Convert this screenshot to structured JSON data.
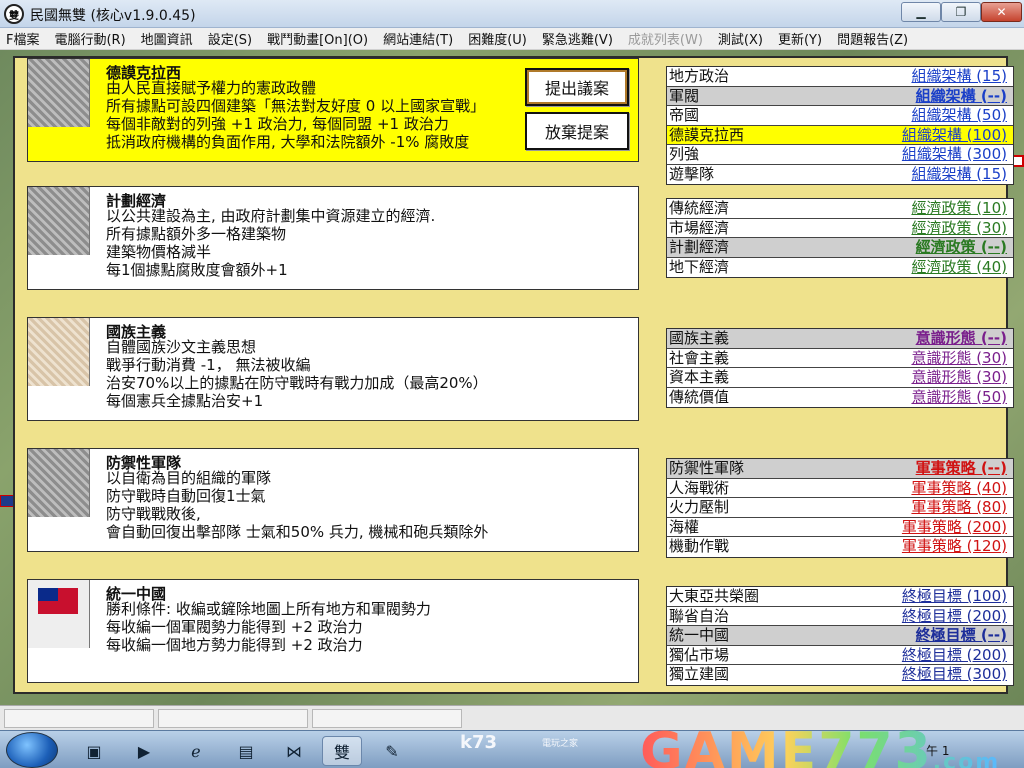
{
  "window": {
    "title": "民國無雙 (核心v1.9.0.45)",
    "icon_text": "雙",
    "minimize_label": "▁",
    "maximize_label": "❐",
    "close_label": "✕"
  },
  "menu": [
    {
      "label": "F檔案",
      "enabled": true
    },
    {
      "label": "電腦行動(R)",
      "enabled": true
    },
    {
      "label": "地圖資訊",
      "enabled": true
    },
    {
      "label": "設定(S)",
      "enabled": true
    },
    {
      "label": "戰鬥動畫[On](O)",
      "enabled": true
    },
    {
      "label": "網站連結(T)",
      "enabled": true
    },
    {
      "label": "困難度(U)",
      "enabled": true
    },
    {
      "label": "緊急逃難(V)",
      "enabled": true
    },
    {
      "label": "成就列表(W)",
      "enabled": false
    },
    {
      "label": "測試(X)",
      "enabled": true
    },
    {
      "label": "更新(Y)",
      "enabled": true
    },
    {
      "label": "問題報告(Z)",
      "enabled": true
    }
  ],
  "actions": {
    "propose": "提出議案",
    "abandon": "放棄提案"
  },
  "policies": [
    {
      "title": "德謨克拉西",
      "image": "policy-portrait-image",
      "lines": [
        "由人民直接賦予權力的憲政政體",
        "所有據點可設四個建築「無法對友好度 0 以上國家宣戰」",
        "每個非敵對的列強 +1 政治力, 每個同盟 +1 政治力",
        "抵消政府機構的負面作用, 大學和法院額外 -1% 腐敗度"
      ]
    },
    {
      "title": "計劃經濟",
      "image": "policy-portrait-image",
      "lines": [
        "以公共建設為主, 由政府計劃集中資源建立的經濟.",
        "所有據點額外多一格建築物",
        "建築物價格減半",
        "每1個據點腐敗度會額外+1"
      ]
    },
    {
      "title": "國族主義",
      "image": "policy-poster-image",
      "lines": [
        "自體國族沙文主義思想",
        "戰爭行動消費 -1， 無法被收編",
        "治安70%以上的據點在防守戰時有戰力加成（最高20%）",
        "每個憲兵全據點治安+1"
      ]
    },
    {
      "title": "防禦性軍隊",
      "image": "policy-portrait-image",
      "lines": [
        "以自衛為目的組織的軍隊",
        "防守戰時自動回復1士氣",
        "防守戰戰敗後,",
        "會自動回復出擊部隊 士氣和50% 兵力, 機械和砲兵類除外"
      ]
    },
    {
      "title": "統一中國",
      "image": "policy-flag-image",
      "lines": [
        "勝利條件: 收編或鏟除地圖上所有地方和軍閥勢力",
        "每收編一個軍閥勢力能得到 +2 政治力",
        "每收編一個地方勢力能得到 +2 政治力"
      ]
    }
  ],
  "option_groups": [
    {
      "color": "blue",
      "items": [
        {
          "name": "地方政治",
          "category": "組織架構 (15)",
          "state": "normal"
        },
        {
          "name": "軍閥",
          "category": "組織架構 (--)",
          "state": "active"
        },
        {
          "name": "帝國",
          "category": "組織架構 (50)",
          "state": "normal"
        },
        {
          "name": "德謨克拉西",
          "category": "組織架構 (100)",
          "state": "highlight"
        },
        {
          "name": "列強",
          "category": "組織架構 (300)",
          "state": "normal"
        },
        {
          "name": "遊擊隊",
          "category": "組織架構 (15)",
          "state": "normal"
        }
      ]
    },
    {
      "color": "green",
      "items": [
        {
          "name": "傳統經濟",
          "category": "經濟政策 (10)",
          "state": "normal"
        },
        {
          "name": "市場經濟",
          "category": "經濟政策 (30)",
          "state": "normal"
        },
        {
          "name": "計劃經濟",
          "category": "經濟政策 (--)",
          "state": "active"
        },
        {
          "name": "地下經濟",
          "category": "經濟政策 (40)",
          "state": "normal"
        }
      ]
    },
    {
      "color": "purple",
      "items": [
        {
          "name": "國族主義",
          "category": "意識形態 (--)",
          "state": "active"
        },
        {
          "name": "社會主義",
          "category": "意識形態 (30)",
          "state": "normal"
        },
        {
          "name": "資本主義",
          "category": "意識形態 (30)",
          "state": "normal"
        },
        {
          "name": "傳統價值",
          "category": "意識形態 (50)",
          "state": "normal"
        }
      ]
    },
    {
      "color": "red",
      "items": [
        {
          "name": "防禦性軍隊",
          "category": "軍事策略 (--)",
          "state": "active"
        },
        {
          "name": "人海戰術",
          "category": "軍事策略 (40)",
          "state": "normal"
        },
        {
          "name": "火力壓制",
          "category": "軍事策略 (80)",
          "state": "normal"
        },
        {
          "name": "海權",
          "category": "軍事策略 (200)",
          "state": "normal"
        },
        {
          "name": "機動作戰",
          "category": "軍事策略 (120)",
          "state": "normal"
        }
      ]
    },
    {
      "color": "navy",
      "items": [
        {
          "name": "大東亞共榮圈",
          "category": "終極目標 (100)",
          "state": "normal"
        },
        {
          "name": "聯省自治",
          "category": "終極目標 (200)",
          "state": "normal"
        },
        {
          "name": "統一中國",
          "category": "終極目標 (--)",
          "state": "active"
        },
        {
          "name": "獨佔市場",
          "category": "終極目標 (200)",
          "state": "normal"
        },
        {
          "name": "獨立建國",
          "category": "終極目標 (300)",
          "state": "normal"
        }
      ]
    }
  ],
  "taskbar": {
    "watermark_site": "k73",
    "watermark_site_sub": "電玩之家",
    "watermark_brand": "GAME773",
    "watermark_brand_sub": ".com",
    "tray_text": "午 1"
  },
  "colors": {
    "panel_bg": "#efe28c",
    "selected_policy_bg": "#ffff00",
    "active_row_bg": "#cfcfcf",
    "category_blue": "#1a3fc8",
    "category_green": "#2a7a22",
    "category_purple": "#7a1f8c",
    "category_red": "#d01212",
    "category_navy": "#1d2e9a"
  }
}
